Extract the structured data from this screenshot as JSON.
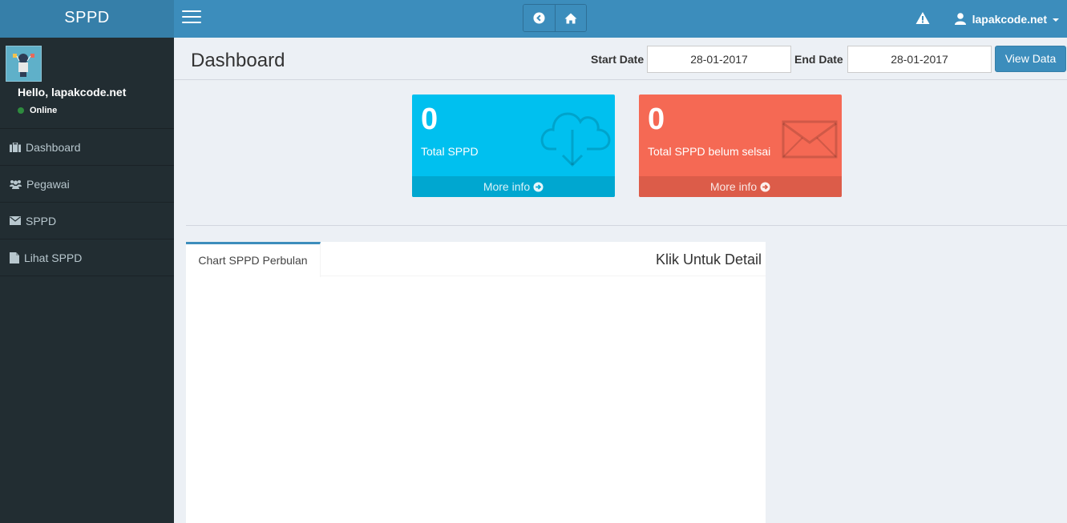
{
  "app": {
    "title": "SPPD"
  },
  "header": {
    "user_name": "lapakcode.net"
  },
  "sidebar": {
    "hello": "Hello, lapakcode.net",
    "status": "Online",
    "items": [
      {
        "label": "Dashboard",
        "icon": "briefcase-icon"
      },
      {
        "label": "Pegawai",
        "icon": "users-icon"
      },
      {
        "label": "SPPD",
        "icon": "envelope-icon"
      },
      {
        "label": "Lihat SPPD",
        "icon": "file-icon"
      }
    ]
  },
  "content": {
    "title": "Dashboard",
    "start_label": "Start Date",
    "start_value": "28-01-2017",
    "end_label": "End Date",
    "end_value": "28-01-2017",
    "view_button": "View Data"
  },
  "boxes": [
    {
      "value": "0",
      "label": "Total SPPD",
      "more": "More info",
      "icon": "cloud-download-icon",
      "color": "#00c0ef"
    },
    {
      "value": "0",
      "label": "Total SPPD belum selsai",
      "more": "More info",
      "icon": "envelope-icon",
      "color": "#f56954"
    }
  ],
  "chart_panel": {
    "tab_label": "Chart SPPD Perbulan",
    "header": "Klik Untuk Detail"
  },
  "colors": {
    "primary": "#3c8dbc",
    "primary_dark": "#367fa9",
    "sidebar": "#222d32"
  }
}
